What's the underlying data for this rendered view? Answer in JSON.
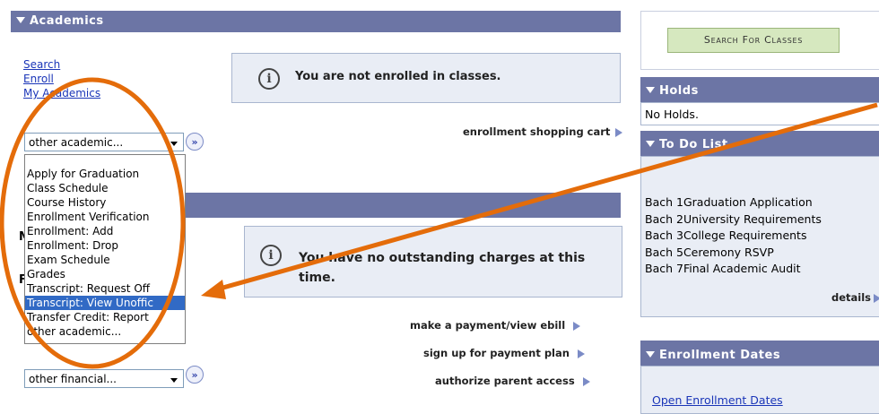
{
  "academics": {
    "title": "Academics",
    "links": [
      "Search",
      "Enroll",
      "My Academics"
    ],
    "not_enrolled_msg": "You are not enrolled in classes.",
    "shopping_cart": "enrollment shopping cart",
    "select_value": "other academic...",
    "dropdown_options": [
      "Apply for Graduation",
      "Class Schedule",
      "Course History",
      "Enrollment Verification",
      "Enrollment: Add",
      "Enrollment: Drop",
      "Exam Schedule",
      "Grades",
      "Transcript: Request Off",
      "Transcript: View Unoffic",
      "Transfer Credit: Report",
      "other academic..."
    ],
    "selected_option": "Transcript: View Unoffic"
  },
  "finances": {
    "partial_letter_1": "M",
    "partial_letter_2": "F",
    "no_charges_msg": "You have no outstanding charges at this time.",
    "actions": [
      "make a payment/view ebill",
      "sign up for payment plan",
      "authorize parent access"
    ],
    "select_value": "other financial..."
  },
  "right": {
    "search_button": "Search For Classes",
    "holds_title": "Holds",
    "holds_text": "No Holds.",
    "todo_title": "To Do List",
    "todo_items": [
      "Bach 1Graduation Application",
      "Bach 2University Requirements",
      "Bach 3College Requirements",
      "Bach 5Ceremony RSVP",
      "Bach 7Final Academic Audit"
    ],
    "details_link": "details",
    "enroll_dates_title": "Enrollment Dates",
    "open_enroll_link": "Open Enrollment Dates"
  },
  "annotation": {
    "color": "#e46c0a"
  }
}
